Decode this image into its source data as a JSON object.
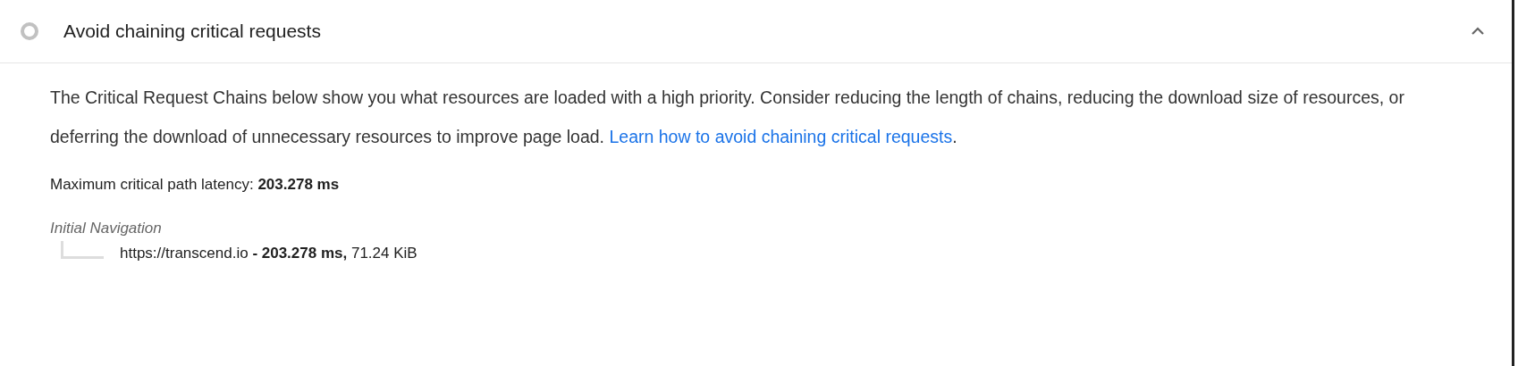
{
  "audit": {
    "title": "Avoid chaining critical requests",
    "expanded": true,
    "description": "The Critical Request Chains below show you what resources are loaded with a high priority. Consider reducing the length of chains, reducing the download size of resources, or deferring the download of unnecessary resources to improve page load.",
    "link": "Learn how to avoid chaining critical requests",
    "link_end": "."
  },
  "summary": {
    "label": "Maximum critical path latency:",
    "value": "203.278 ms"
  },
  "chain": {
    "title": "Initial Navigation",
    "children": [
      {
        "url": "https://transcend.io",
        "time": "- 203.278 ms,",
        "size": "71.24 KiB"
      }
    ]
  }
}
